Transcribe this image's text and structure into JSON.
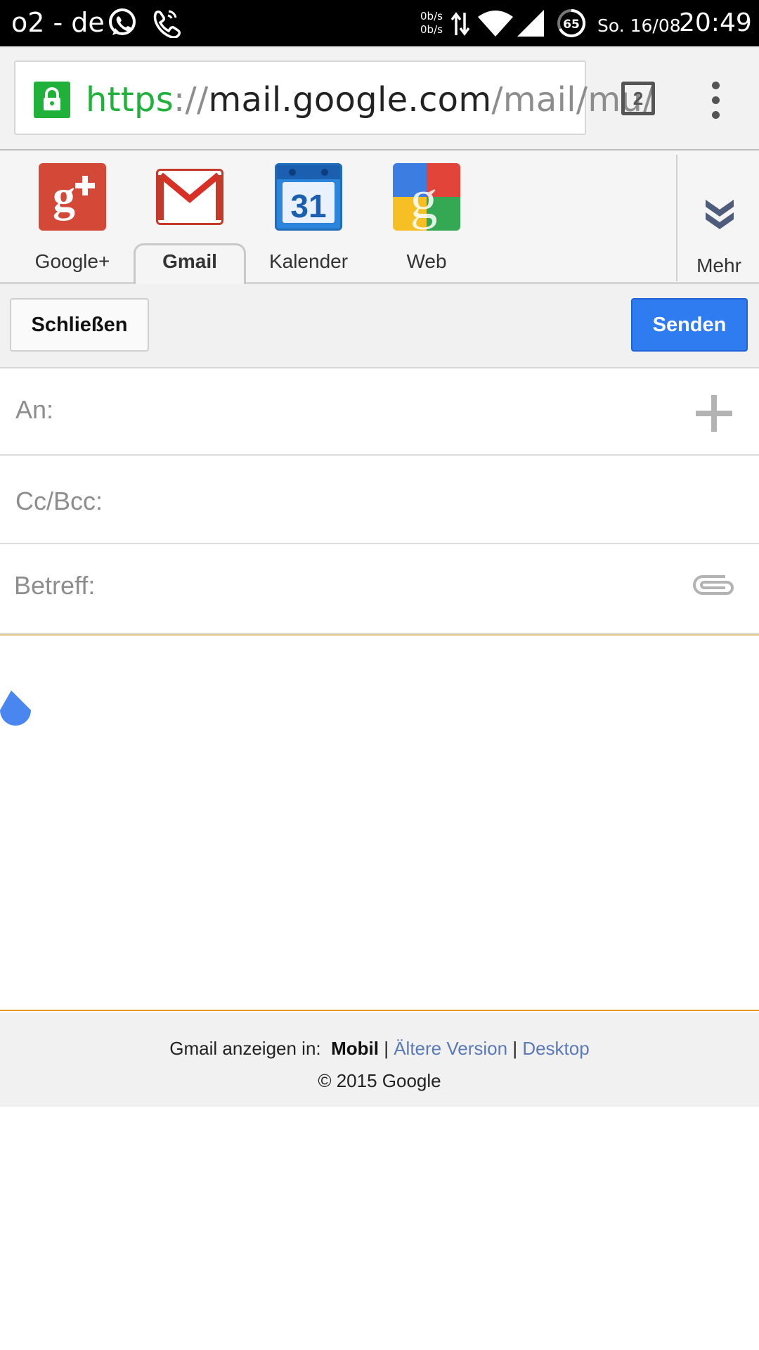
{
  "status_bar": {
    "carrier": "o2 - de",
    "speed_up": "0b/s",
    "speed_down": "0b/s",
    "battery": "65",
    "date": "So. 16/08",
    "time": "20:49"
  },
  "browser": {
    "url_scheme": "https",
    "url_sep": "://",
    "url_host": "mail.google.com",
    "url_path": "/mail/mu/",
    "tab_count": "2"
  },
  "app_bar": {
    "apps": [
      {
        "label": "Google+"
      },
      {
        "label": "Gmail"
      },
      {
        "label": "Kalender"
      },
      {
        "label": "Web"
      }
    ],
    "more_label": "Mehr",
    "calendar_day": "31"
  },
  "compose": {
    "close_label": "Schließen",
    "send_label": "Senden",
    "to_label": "An:",
    "cc_label": "Cc/Bcc:",
    "subject_label": "Betreff:"
  },
  "footer": {
    "view_in": "Gmail anzeigen in:",
    "mobile": "Mobil",
    "separator": "|",
    "older": "Ältere Version",
    "desktop": "Desktop",
    "copyright": "© 2015 Google"
  },
  "colors": {
    "accent_blue": "#2f7cf0",
    "secure_green": "#1fb13a",
    "gmail_red": "#d93025"
  }
}
